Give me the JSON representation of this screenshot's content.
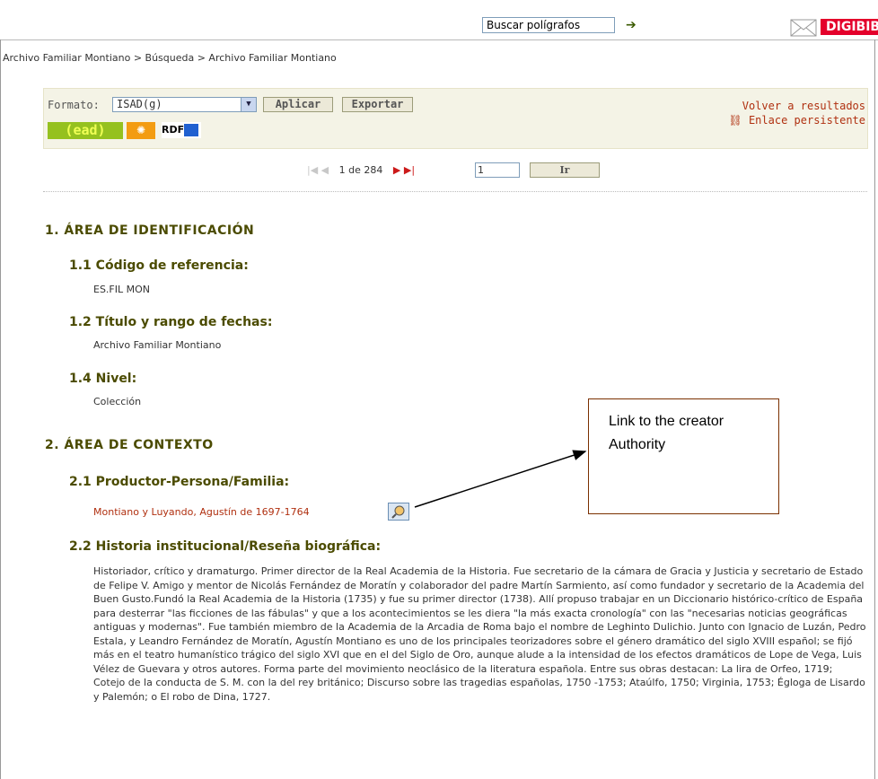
{
  "header": {
    "search_value": "Buscar polígrafos",
    "brand": "DIGIBIB"
  },
  "breadcrumb": "Archivo Familiar Montiano > Búsqueda > Archivo Familiar Montiano",
  "toolbar": {
    "format_label": "Formato:",
    "format_value": "ISAD(g)",
    "apply_label": "Aplicar",
    "export_label": "Exportar",
    "cead_label": "(ead)",
    "rdf_label": "RDF",
    "back_label": "Volver a resultados",
    "permalink_label": "Enlace persistente"
  },
  "pager": {
    "position": "1 de 284",
    "page_input": "1",
    "go_label": "Ir"
  },
  "sections": {
    "s1_title": "1. ÁREA DE IDENTIFICACIÓN",
    "s1_1_title": "1.1 Código de referencia:",
    "s1_1_value": "ES.FIL MON",
    "s1_2_title": "1.2 Título y rango de fechas:",
    "s1_2_value": "Archivo Familiar Montiano",
    "s1_4_title": "1.4 Nivel:",
    "s1_4_value": "Colección",
    "s2_title": "2. ÁREA DE CONTEXTO",
    "s2_1_title": "2.1 Productor-Persona/Familia:",
    "s2_1_value": "Montiano y Luyando, Agustín de 1697-1764",
    "s2_2_title": "2.2 Historia institucional/Reseña biográfica:",
    "s2_2_value": "Historiador, crítico y dramaturgo. Primer director de la Real Academia de la Historia. Fue secretario de la cámara de Gracia y Justicia y secretario de Estado de Felipe V. Amigo y mentor de Nicolás Fernández de Moratín y colaborador del padre Martín Sarmiento, así como fundador y secretario de la Academia del Buen Gusto.Fundó la Real Academia de la Historia (1735) y fue su primer director (1738). Allí propuso trabajar en un Diccionario histórico-crítico de España para desterrar \"las ficciones de las fábulas\" y que a los acontecimientos se les diera \"la más exacta cronología\" con las \"necesarias noticias geográficas antiguas y modernas\". Fue también miembro de la Academia de la Arcadia de Roma bajo el nombre de Leghinto Dulichio. Junto con Ignacio de Luzán, Pedro Estala, y Leandro Fernández de Moratín, Agustín Montiano es uno de los principales teorizadores sobre el género dramático del siglo XVIII español; se fijó más en el teatro humanístico trágico del siglo XVI que en el del Siglo de Oro, aunque alude a la intensidad de los efectos dramáticos de Lope de Vega, Luis Vélez de Guevara y otros autores. Forma parte del movimiento neoclásico de la literatura española. Entre sus obras destacan: La lira de Orfeo, 1719; Cotejo de la conducta de S. M. con la del rey británico; Discurso sobre las tragedias españolas, 1750 -1753; Ataúlfo, 1750; Virginia, 1753; Égloga de Lisardo y Palemón; o El robo de Dina, 1727."
  },
  "callout": {
    "text": "Link to the creator Authority"
  }
}
